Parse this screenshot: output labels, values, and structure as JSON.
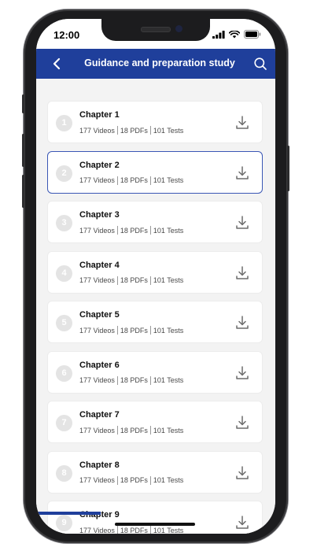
{
  "status_bar": {
    "time": "12:00"
  },
  "header": {
    "title": "Guidance and preparation study",
    "back_icon": "chevron-left-icon",
    "search_icon": "search-icon"
  },
  "colors": {
    "brand": "#1f3f9b",
    "selected_border": "#3a57b5",
    "number_circle": "#e4e4e4"
  },
  "chapters": [
    {
      "number": "1",
      "title": "Chapter 1",
      "videos": "177 Videos",
      "pdfs": "18 PDFs",
      "tests": "101 Tests"
    },
    {
      "number": "2",
      "title": "Chapter 2",
      "videos": "177 Videos",
      "pdfs": "18 PDFs",
      "tests": "101 Tests",
      "selected": true
    },
    {
      "number": "3",
      "title": "Chapter 3",
      "videos": "177 Videos",
      "pdfs": "18 PDFs",
      "tests": "101 Tests"
    },
    {
      "number": "4",
      "title": "Chapter 4",
      "videos": "177 Videos",
      "pdfs": "18 PDFs",
      "tests": "101 Tests"
    },
    {
      "number": "5",
      "title": "Chapter 5",
      "videos": "177 Videos",
      "pdfs": "18 PDFs",
      "tests": "101 Tests"
    },
    {
      "number": "6",
      "title": "Chapter 6",
      "videos": "177 Videos",
      "pdfs": "18 PDFs",
      "tests": "101 Tests"
    },
    {
      "number": "7",
      "title": "Chapter 7",
      "videos": "177 Videos",
      "pdfs": "18 PDFs",
      "tests": "101 Tests"
    },
    {
      "number": "8",
      "title": "Chapter 8",
      "videos": "177 Videos",
      "pdfs": "18 PDFs",
      "tests": "101 Tests"
    },
    {
      "number": "9",
      "title": "Chapter 9",
      "videos": "177 Videos",
      "pdfs": "18 PDFs",
      "tests": "101 Tests"
    }
  ]
}
